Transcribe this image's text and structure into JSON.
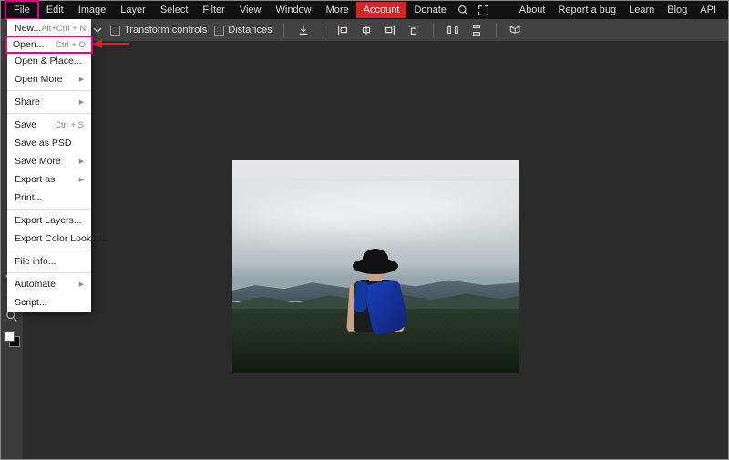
{
  "menubar": {
    "items": [
      "File",
      "Edit",
      "Image",
      "Layer",
      "Select",
      "Filter",
      "View",
      "Window",
      "More"
    ],
    "account": "Account",
    "donate": "Donate",
    "right": [
      "About",
      "Report a bug",
      "Learn",
      "Blog",
      "API"
    ]
  },
  "options": {
    "transform": "Transform controls",
    "distances": "Distances"
  },
  "dropdown": {
    "new": "New...",
    "new_sc": "Alt+Ctrl + N",
    "open": "Open...",
    "open_sc": "Ctrl + O",
    "open_place": "Open & Place...",
    "open_more": "Open More",
    "share": "Share",
    "save": "Save",
    "save_sc": "Ctrl + S",
    "save_psd": "Save as PSD",
    "save_more": "Save More",
    "export_as": "Export as",
    "print": "Print...",
    "export_layers": "Export Layers...",
    "export_color": "Export Color Lookup...",
    "file_info": "File info...",
    "automate": "Automate",
    "script": "Script..."
  }
}
